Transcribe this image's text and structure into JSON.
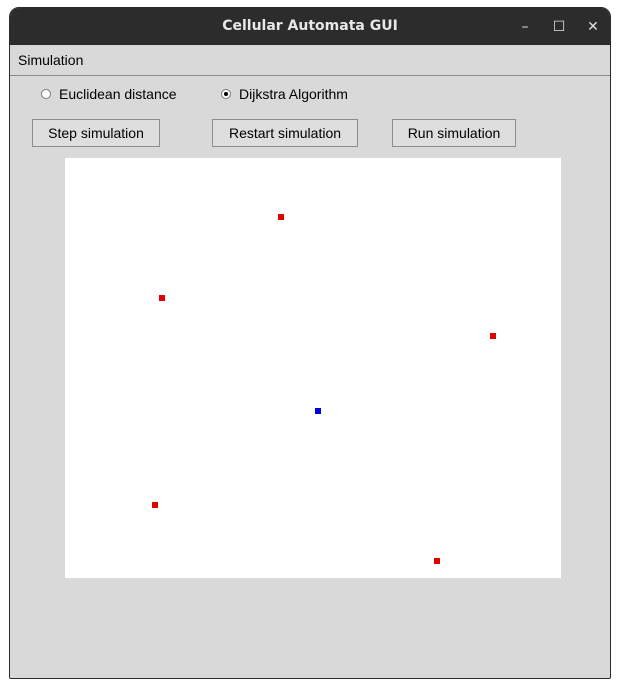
{
  "window": {
    "title": "Cellular Automata GUI",
    "controls": [
      "–",
      "☐",
      "✕"
    ]
  },
  "menubar": {
    "items": [
      "Simulation"
    ]
  },
  "distance_options": [
    {
      "label": "Euclidean distance",
      "selected": false
    },
    {
      "label": "Dijkstra Algorithm",
      "selected": true
    }
  ],
  "buttons": {
    "step": "Step simulation",
    "restart": "Restart simulation",
    "run": "Run simulation"
  },
  "grid": {
    "cells": [
      {
        "color": "#e00000",
        "role": "red"
      },
      {
        "color": "#e00000",
        "role": "red"
      },
      {
        "color": "#e00000",
        "role": "red"
      },
      {
        "color": "#0000dd",
        "role": "blue"
      },
      {
        "color": "#e00000",
        "role": "red"
      },
      {
        "color": "#e00000",
        "role": "red"
      }
    ]
  }
}
